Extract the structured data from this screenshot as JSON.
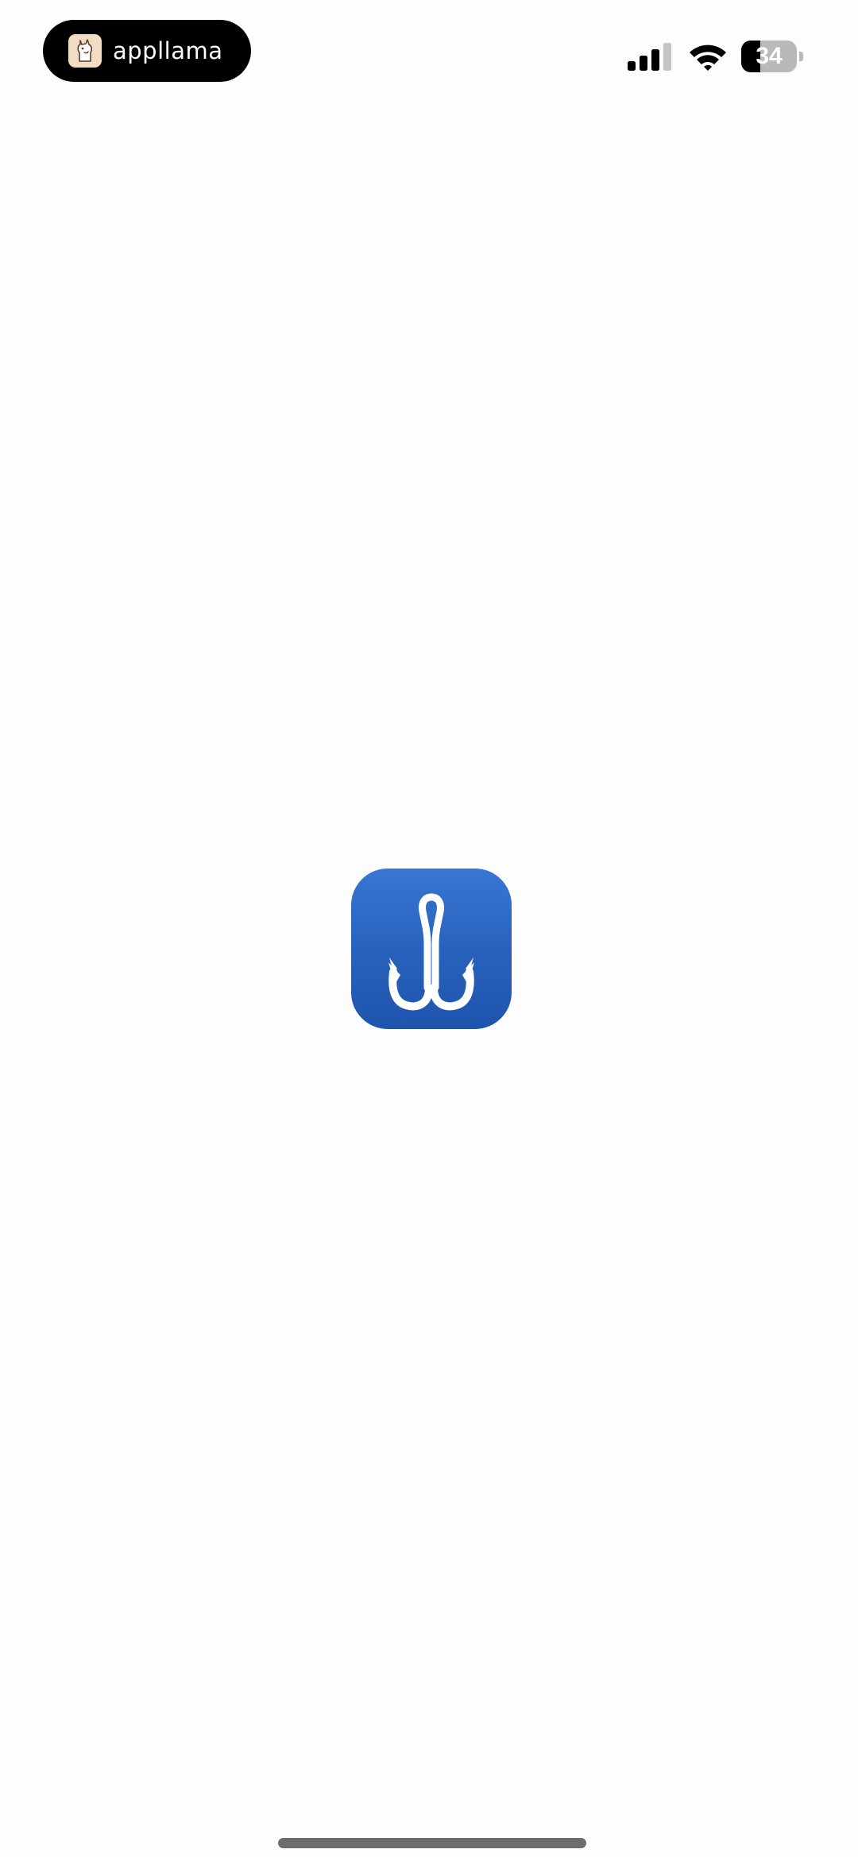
{
  "status_bar": {
    "recorder_label": "appllama",
    "battery_level": "34",
    "battery_fraction": 0.34,
    "signal_bars_active": 3,
    "signal_bars_total": 4
  },
  "splash": {
    "icon": "fishing-hook-icon",
    "icon_color": "#2962bd"
  },
  "colors": {
    "background": "#fdfdfd",
    "pill": "#000000",
    "home_indicator": "#6d6d6d"
  }
}
